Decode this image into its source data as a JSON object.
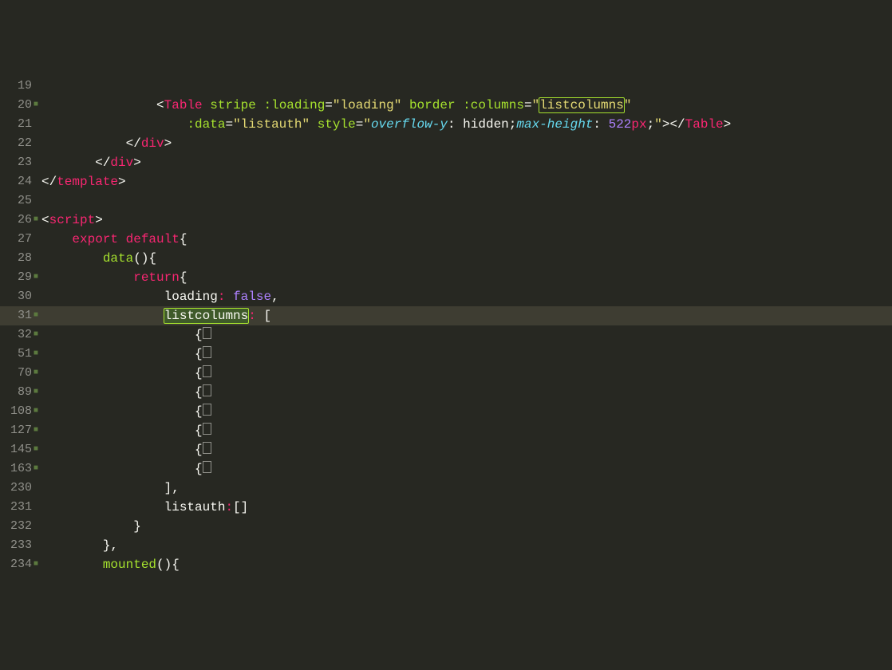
{
  "highlight_word": "listcolumns",
  "current_line": 31,
  "lines": [
    {
      "num": "19",
      "fold": "",
      "tokens": []
    },
    {
      "num": "20",
      "fold": "■",
      "tokens": [
        {
          "t": "               ",
          "c": "c-plain"
        },
        {
          "t": "<",
          "c": "c-punc"
        },
        {
          "t": "Table",
          "c": "c-tag"
        },
        {
          "t": " ",
          "c": "c-plain"
        },
        {
          "t": "stripe",
          "c": "c-attr"
        },
        {
          "t": " ",
          "c": "c-plain"
        },
        {
          "t": ":loading",
          "c": "c-attr"
        },
        {
          "t": "=",
          "c": "c-punc"
        },
        {
          "t": "\"",
          "c": "c-str"
        },
        {
          "t": "loading",
          "c": "c-str"
        },
        {
          "t": "\"",
          "c": "c-str"
        },
        {
          "t": " ",
          "c": "c-plain"
        },
        {
          "t": "border",
          "c": "c-attr"
        },
        {
          "t": " ",
          "c": "c-plain"
        },
        {
          "t": ":columns",
          "c": "c-attr"
        },
        {
          "t": "=",
          "c": "c-punc"
        },
        {
          "t": "\"",
          "c": "c-str"
        },
        {
          "t": "listcolumns",
          "c": "c-str",
          "sel": true
        },
        {
          "t": "\"",
          "c": "c-str"
        }
      ]
    },
    {
      "num": "21",
      "fold": "",
      "tokens": [
        {
          "t": "                   ",
          "c": "c-plain"
        },
        {
          "t": ":data",
          "c": "c-attr"
        },
        {
          "t": "=",
          "c": "c-punc"
        },
        {
          "t": "\"",
          "c": "c-str"
        },
        {
          "t": "listauth",
          "c": "c-str"
        },
        {
          "t": "\"",
          "c": "c-str"
        },
        {
          "t": " ",
          "c": "c-plain"
        },
        {
          "t": "style",
          "c": "c-attr"
        },
        {
          "t": "=",
          "c": "c-punc"
        },
        {
          "t": "\"",
          "c": "c-str"
        },
        {
          "t": "overflow-y",
          "c": "c-css-prop"
        },
        {
          "t": ": ",
          "c": "c-punc"
        },
        {
          "t": "hidden",
          "c": "c-plain"
        },
        {
          "t": ";",
          "c": "c-punc"
        },
        {
          "t": "max-height",
          "c": "c-css-prop"
        },
        {
          "t": ": ",
          "c": "c-punc"
        },
        {
          "t": "522",
          "c": "c-num"
        },
        {
          "t": "px",
          "c": "c-kw"
        },
        {
          "t": ";",
          "c": "c-punc"
        },
        {
          "t": "\"",
          "c": "c-str"
        },
        {
          "t": ">",
          "c": "c-punc"
        },
        {
          "t": "</",
          "c": "c-punc"
        },
        {
          "t": "Table",
          "c": "c-tag"
        },
        {
          "t": ">",
          "c": "c-punc"
        }
      ]
    },
    {
      "num": "22",
      "fold": "",
      "tokens": [
        {
          "t": "           ",
          "c": "c-plain"
        },
        {
          "t": "</",
          "c": "c-punc"
        },
        {
          "t": "div",
          "c": "c-tag"
        },
        {
          "t": ">",
          "c": "c-punc"
        }
      ]
    },
    {
      "num": "23",
      "fold": "",
      "tokens": [
        {
          "t": "       ",
          "c": "c-plain"
        },
        {
          "t": "</",
          "c": "c-punc"
        },
        {
          "t": "div",
          "c": "c-tag"
        },
        {
          "t": ">",
          "c": "c-punc"
        }
      ]
    },
    {
      "num": "24",
      "fold": "",
      "tokens": [
        {
          "t": "</",
          "c": "c-punc"
        },
        {
          "t": "template",
          "c": "c-tag"
        },
        {
          "t": ">",
          "c": "c-punc"
        }
      ]
    },
    {
      "num": "25",
      "fold": "",
      "tokens": []
    },
    {
      "num": "26",
      "fold": "■",
      "tokens": [
        {
          "t": "<",
          "c": "c-punc"
        },
        {
          "t": "script",
          "c": "c-tag"
        },
        {
          "t": ">",
          "c": "c-punc"
        }
      ]
    },
    {
      "num": "27",
      "fold": "",
      "tokens": [
        {
          "t": "    ",
          "c": "c-plain"
        },
        {
          "t": "export",
          "c": "c-kw"
        },
        {
          "t": " ",
          "c": "c-plain"
        },
        {
          "t": "default",
          "c": "c-kw"
        },
        {
          "t": "{",
          "c": "c-punc"
        }
      ]
    },
    {
      "num": "28",
      "fold": "",
      "tokens": [
        {
          "t": "        ",
          "c": "c-plain"
        },
        {
          "t": "data",
          "c": "c-fn"
        },
        {
          "t": "(){",
          "c": "c-punc"
        }
      ]
    },
    {
      "num": "29",
      "fold": "■",
      "tokens": [
        {
          "t": "            ",
          "c": "c-plain"
        },
        {
          "t": "return",
          "c": "c-kw"
        },
        {
          "t": "{",
          "c": "c-punc"
        }
      ]
    },
    {
      "num": "30",
      "fold": "",
      "tokens": [
        {
          "t": "                ",
          "c": "c-plain"
        },
        {
          "t": "loading",
          "c": "c-plain"
        },
        {
          "t": ":",
          "c": "c-kw"
        },
        {
          "t": " ",
          "c": "c-plain"
        },
        {
          "t": "false",
          "c": "c-lit"
        },
        {
          "t": ",",
          "c": "c-punc"
        }
      ]
    },
    {
      "num": "31",
      "fold": "■",
      "hl": true,
      "tokens": [
        {
          "t": "                ",
          "c": "c-plain"
        },
        {
          "t": "listcolumns",
          "c": "c-plain",
          "sel_act": true
        },
        {
          "t": ":",
          "c": "c-kw"
        },
        {
          "t": " [",
          "c": "c-punc"
        }
      ]
    },
    {
      "num": "32",
      "fold": "■",
      "tokens": [
        {
          "t": "                    ",
          "c": "c-plain"
        },
        {
          "t": "{",
          "c": "c-punc"
        },
        {
          "folded": true
        }
      ]
    },
    {
      "num": "51",
      "fold": "■",
      "tokens": [
        {
          "t": "                    ",
          "c": "c-plain"
        },
        {
          "t": "{",
          "c": "c-punc"
        },
        {
          "folded": true
        }
      ]
    },
    {
      "num": "70",
      "fold": "■",
      "tokens": [
        {
          "t": "                    ",
          "c": "c-plain"
        },
        {
          "t": "{",
          "c": "c-punc"
        },
        {
          "folded": true
        }
      ]
    },
    {
      "num": "89",
      "fold": "■",
      "tokens": [
        {
          "t": "                    ",
          "c": "c-plain"
        },
        {
          "t": "{",
          "c": "c-punc"
        },
        {
          "folded": true
        }
      ]
    },
    {
      "num": "108",
      "fold": "■",
      "tokens": [
        {
          "t": "                    ",
          "c": "c-plain"
        },
        {
          "t": "{",
          "c": "c-punc"
        },
        {
          "folded": true
        }
      ]
    },
    {
      "num": "127",
      "fold": "■",
      "tokens": [
        {
          "t": "                    ",
          "c": "c-plain"
        },
        {
          "t": "{",
          "c": "c-punc"
        },
        {
          "folded": true
        }
      ]
    },
    {
      "num": "145",
      "fold": "■",
      "tokens": [
        {
          "t": "                    ",
          "c": "c-plain"
        },
        {
          "t": "{",
          "c": "c-punc"
        },
        {
          "folded": true
        }
      ]
    },
    {
      "num": "163",
      "fold": "■",
      "tokens": [
        {
          "t": "                    ",
          "c": "c-plain"
        },
        {
          "t": "{",
          "c": "c-punc"
        },
        {
          "folded": true
        }
      ]
    },
    {
      "num": "230",
      "fold": "",
      "tokens": [
        {
          "t": "                ",
          "c": "c-plain"
        },
        {
          "t": "],",
          "c": "c-punc"
        }
      ]
    },
    {
      "num": "231",
      "fold": "",
      "tokens": [
        {
          "t": "                ",
          "c": "c-plain"
        },
        {
          "t": "listauth",
          "c": "c-plain"
        },
        {
          "t": ":",
          "c": "c-kw"
        },
        {
          "t": "[]",
          "c": "c-punc"
        }
      ]
    },
    {
      "num": "232",
      "fold": "",
      "tokens": [
        {
          "t": "            ",
          "c": "c-plain"
        },
        {
          "t": "}",
          "c": "c-punc"
        }
      ]
    },
    {
      "num": "233",
      "fold": "",
      "tokens": [
        {
          "t": "        ",
          "c": "c-plain"
        },
        {
          "t": "},",
          "c": "c-punc"
        }
      ]
    },
    {
      "num": "234",
      "fold": "■",
      "tokens": [
        {
          "t": "        ",
          "c": "c-plain"
        },
        {
          "t": "mounted",
          "c": "c-fn"
        },
        {
          "t": "(){",
          "c": "c-punc"
        }
      ]
    }
  ]
}
